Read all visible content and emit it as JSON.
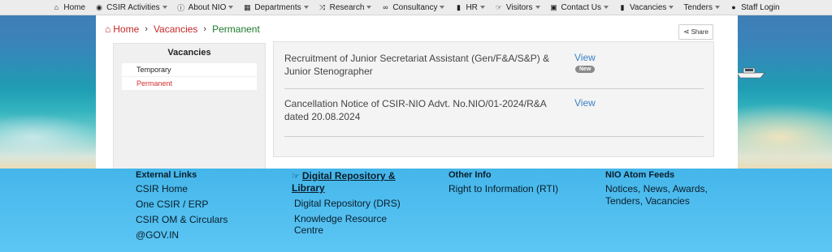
{
  "nav": {
    "items": [
      {
        "icon": "home-icon",
        "glyph": "⌂",
        "label": "Home",
        "dropdown": false
      },
      {
        "icon": "gear-icon",
        "glyph": "◉",
        "label": "CSIR Activities",
        "dropdown": true
      },
      {
        "icon": "info-icon",
        "glyph": "ⓘ",
        "label": "About NIO",
        "dropdown": true
      },
      {
        "icon": "building-icon",
        "glyph": "▦",
        "label": "Departments",
        "dropdown": true
      },
      {
        "icon": "shuffle-icon",
        "glyph": "⤨",
        "label": "Research",
        "dropdown": true
      },
      {
        "icon": "handshake-icon",
        "glyph": "∞",
        "label": "Consultancy",
        "dropdown": true
      },
      {
        "icon": "briefcase-icon",
        "glyph": "▮",
        "label": "HR",
        "dropdown": true
      },
      {
        "icon": "pointer-icon",
        "glyph": "☞",
        "label": "Visitors",
        "dropdown": true
      },
      {
        "icon": "contact-card-icon",
        "glyph": "▣",
        "label": "Contact Us",
        "dropdown": true
      },
      {
        "icon": "briefcase-icon",
        "glyph": "▮",
        "label": "Vacancies",
        "dropdown": true
      },
      {
        "icon": "",
        "glyph": "",
        "label": "Tenders",
        "dropdown": true
      },
      {
        "icon": "user-icon",
        "glyph": "●",
        "label": "Staff Login",
        "dropdown": false
      }
    ]
  },
  "breadcrumb": {
    "home": "Home",
    "section": "Vacancies",
    "current": "Permanent"
  },
  "share": {
    "label": "Share"
  },
  "sidebar": {
    "title": "Vacancies",
    "items": [
      {
        "label": "Temporary"
      },
      {
        "label": "Permanent"
      }
    ]
  },
  "vacancies": [
    {
      "title": "Recruitment of Junior Secretariat Assistant (Gen/F&A/S&P) & Junior Stenographer",
      "link": "View",
      "badge": "New"
    },
    {
      "title": "Cancellation Notice of CSIR-NIO Advt. No.NIO/01-2024/R&A dated 20.08.2024",
      "link": "View",
      "badge": ""
    }
  ],
  "footer": {
    "external": {
      "heading": "External Links",
      "links": [
        "CSIR Home",
        "One CSIR / ERP",
        "CSIR OM & Circulars",
        "@GOV.IN"
      ]
    },
    "digital": {
      "heading": "Digital Repository & Library",
      "links": [
        "Digital Repository (DRS)",
        "Knowledge Resource Centre"
      ]
    },
    "other": {
      "heading": "Other Info",
      "links": [
        "Right to Information (RTI)"
      ]
    },
    "atom": {
      "heading": "NIO Atom Feeds",
      "links": [
        "Notices, News, Awards, Tenders, Vacancies"
      ]
    }
  },
  "colors": {
    "accent_red": "#c62828",
    "breadcrumb_current": "#1d7a2a",
    "link_blue": "#3d7fc4",
    "footer_bg": "#4dbcee"
  }
}
